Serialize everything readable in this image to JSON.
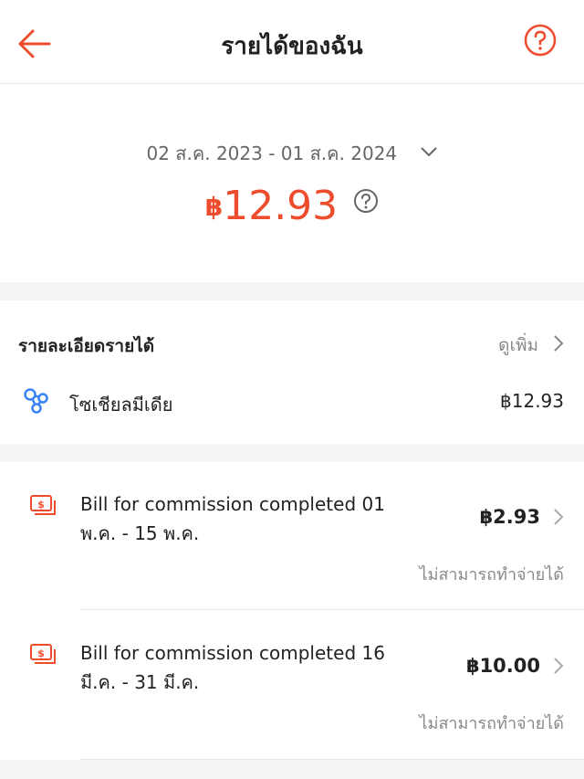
{
  "header": {
    "title": "รายได้ของฉัน",
    "back_icon": "arrow-left-icon",
    "help_icon": "question-circle-icon"
  },
  "summary": {
    "date_range": "02 ส.ค. 2023 - 01 ส.ค. 2024",
    "currency_symbol": "฿",
    "total_amount": "12.93"
  },
  "details": {
    "title": "รายละเอียดรายได้",
    "see_more_label": "ดูเพิ่ม",
    "items": [
      {
        "icon": "social-network-icon",
        "label": "โซเชียลมีเดีย",
        "amount": "฿12.93"
      }
    ]
  },
  "bills": [
    {
      "title": "Bill for commission completed 01 พ.ค. - 15 พ.ค.",
      "amount": "฿2.93",
      "status": "ไม่สามารถทำจ่ายได้"
    },
    {
      "title": "Bill for commission completed 16 มี.ค. - 31 มี.ค.",
      "amount": "฿10.00",
      "status": "ไม่สามารถทำจ่ายได้"
    }
  ],
  "colors": {
    "accent": "#ee4d2d",
    "social_icon": "#3b82f6",
    "muted_text": "#888888"
  }
}
